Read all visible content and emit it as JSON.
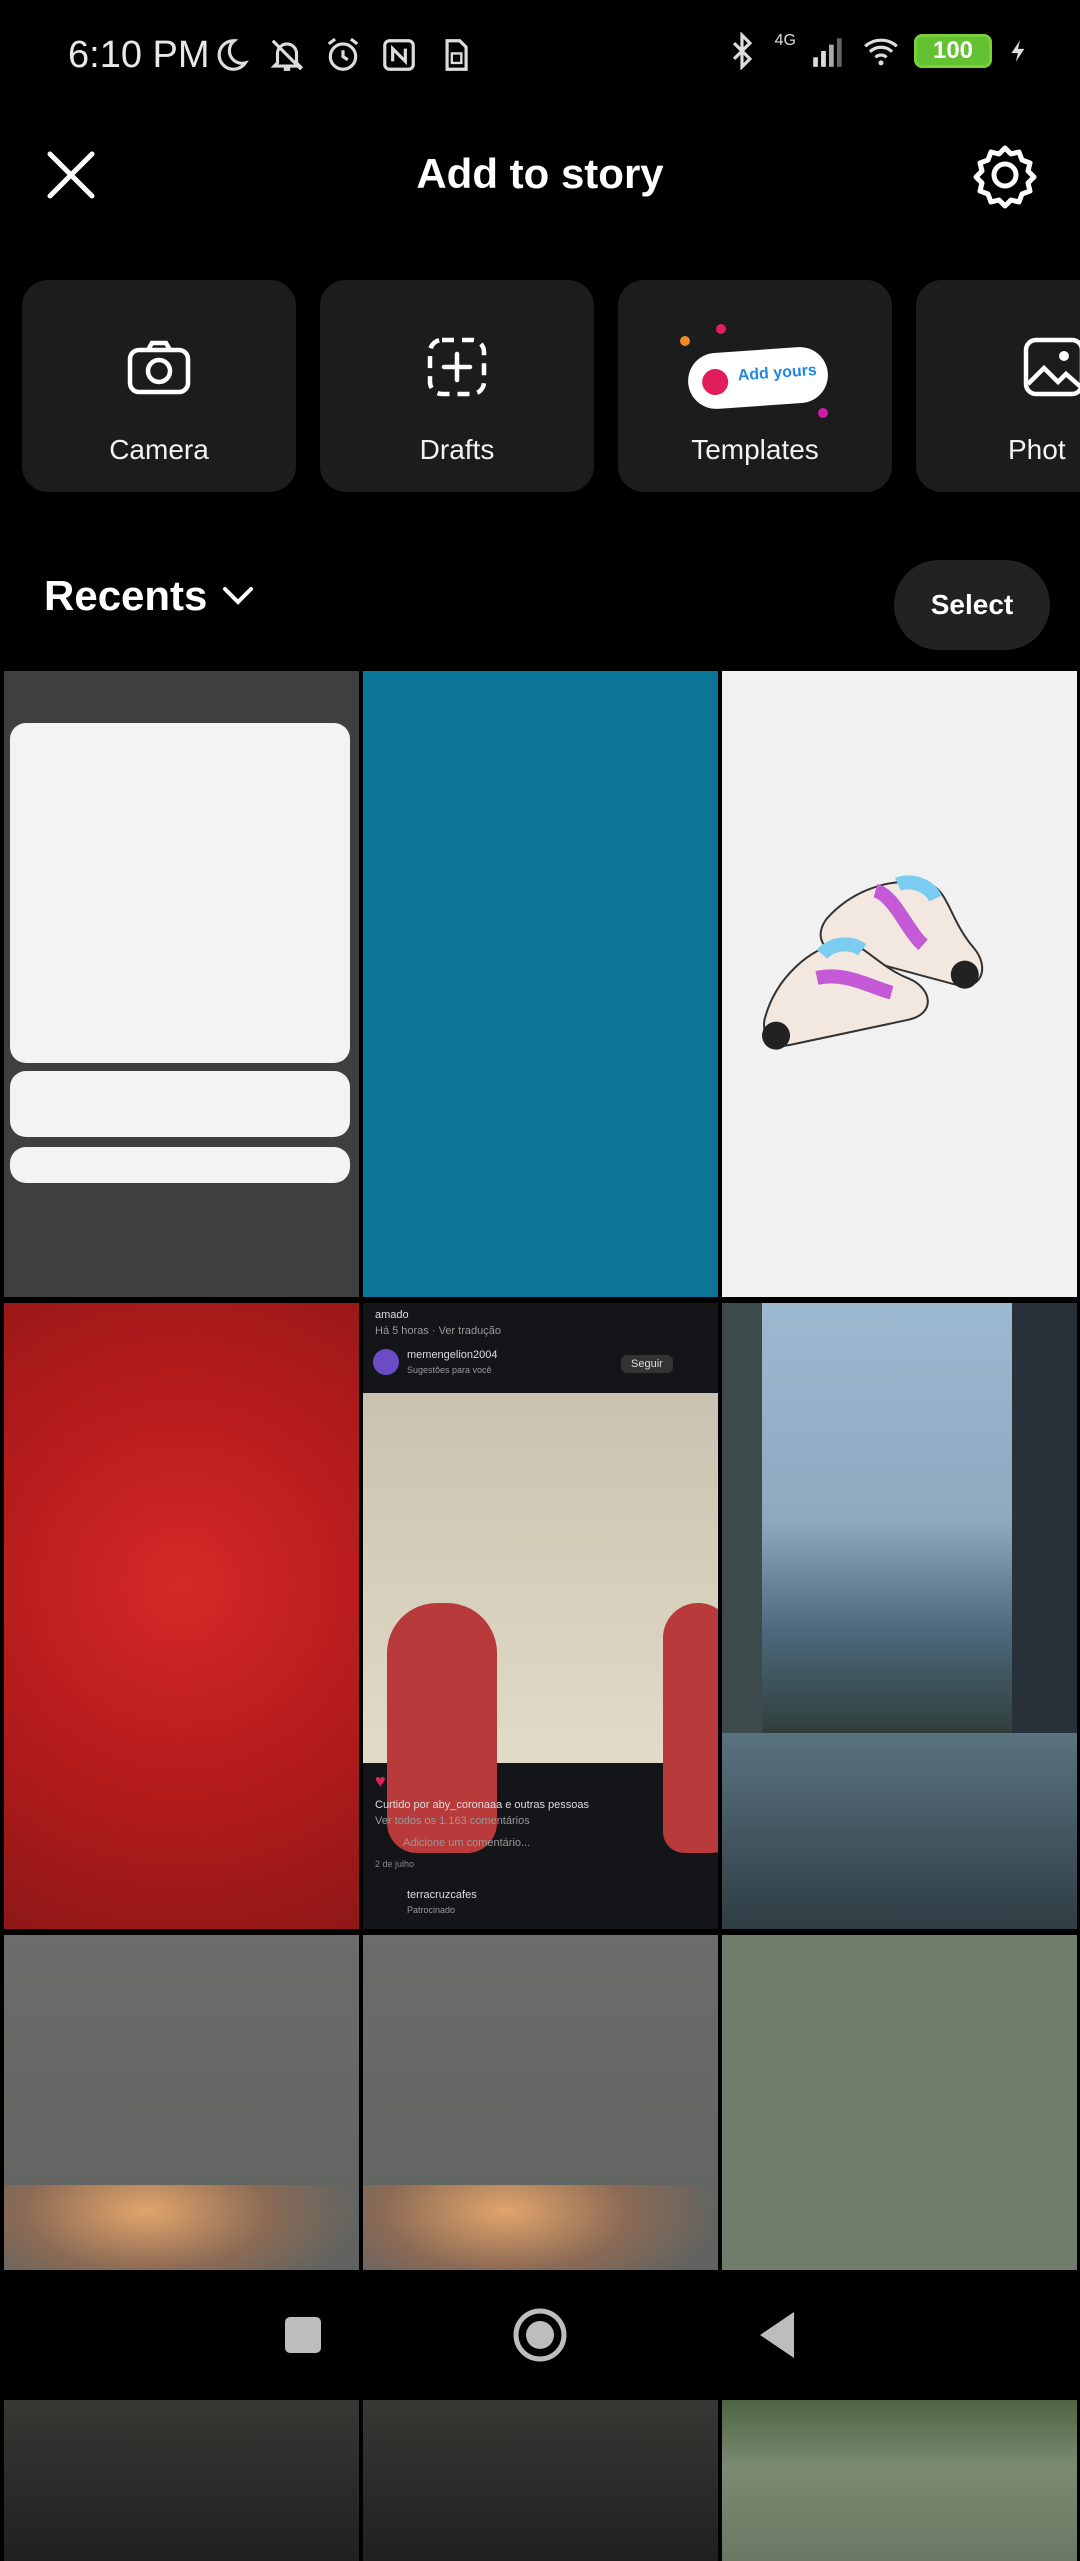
{
  "status_bar": {
    "time": "6:10 PM",
    "network_label": "4G",
    "battery_level": "100",
    "icons": [
      "moon-icon",
      "notifications-off-icon",
      "alarm-icon",
      "nfc-icon",
      "sim-icon",
      "bluetooth-icon",
      "signal-icon",
      "wifi-icon",
      "battery-icon",
      "charging-icon"
    ]
  },
  "header": {
    "title": "Add to story",
    "close_icon": "close-icon",
    "settings_icon": "settings-icon"
  },
  "tiles": [
    {
      "label": "Camera",
      "icon": "camera-icon"
    },
    {
      "label": "Drafts",
      "icon": "drafts-icon"
    },
    {
      "label": "Templates",
      "icon": "templates-icon",
      "badge": "Add yours"
    },
    {
      "label": "Phot",
      "icon": "photo-icon"
    }
  ],
  "recents": {
    "label": "Recents",
    "select_label": "Select"
  },
  "grid_post": {
    "author_line": "amado",
    "time_line": "Há 5 horas · Ver tradução",
    "username": "memengelion2004",
    "suggest": "Sugestões para você",
    "follow": "Seguir",
    "liked_by": "Curtido por aby_coronaaa e outras pessoas",
    "comments": "Ver todos os 1.163 comentários",
    "add_comment": "Adicione um comentário...",
    "date": "2 de julho",
    "sponsor": "terracruzcafes",
    "sponsored": "Patrocinado"
  },
  "colors": {
    "background": "#000000",
    "tile_bg": "#1c1c1c",
    "select_bg": "#222222",
    "accent_blue": "#1e88e5",
    "accent_pink": "#e11d5c"
  }
}
